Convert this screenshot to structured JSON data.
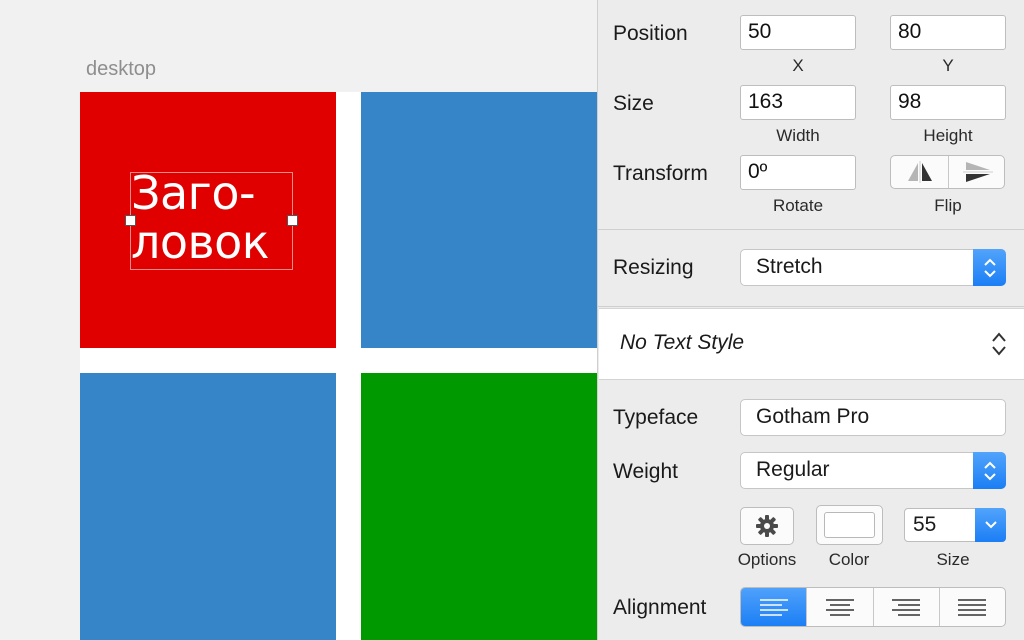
{
  "canvas": {
    "artboard_label": "desktop",
    "heading_text": "Заго-\nловок",
    "colors": {
      "red": "#e00000",
      "blue": "#3585c8",
      "green": "#009a00",
      "background": "#f1f1f1"
    }
  },
  "inspector": {
    "position": {
      "label": "Position",
      "x_value": "50",
      "y_value": "80",
      "x_label": "X",
      "y_label": "Y"
    },
    "size": {
      "label": "Size",
      "width_value": "163",
      "height_value": "98",
      "width_label": "Width",
      "height_label": "Height"
    },
    "transform": {
      "label": "Transform",
      "rotate_value": "0º",
      "rotate_label": "Rotate",
      "flip_label": "Flip"
    },
    "resizing": {
      "label": "Resizing",
      "value": "Stretch"
    },
    "text_style": {
      "value": "No Text Style"
    },
    "typeface": {
      "label": "Typeface",
      "value": "Gotham Pro"
    },
    "weight": {
      "label": "Weight",
      "value": "Regular"
    },
    "font_controls": {
      "options_label": "Options",
      "color_label": "Color",
      "size_label": "Size",
      "size_value": "55"
    },
    "alignment": {
      "label": "Alignment",
      "selected": "left",
      "options": [
        "left",
        "center",
        "right",
        "justify"
      ]
    },
    "icons": [
      "flip-horizontal-icon",
      "flip-vertical-icon",
      "gear-icon",
      "stepper-chevrons-icon",
      "chevron-down-icon",
      "align-left-icon",
      "align-center-icon",
      "align-right-icon",
      "align-justify-icon"
    ],
    "accent_color": "#1e80f5"
  }
}
